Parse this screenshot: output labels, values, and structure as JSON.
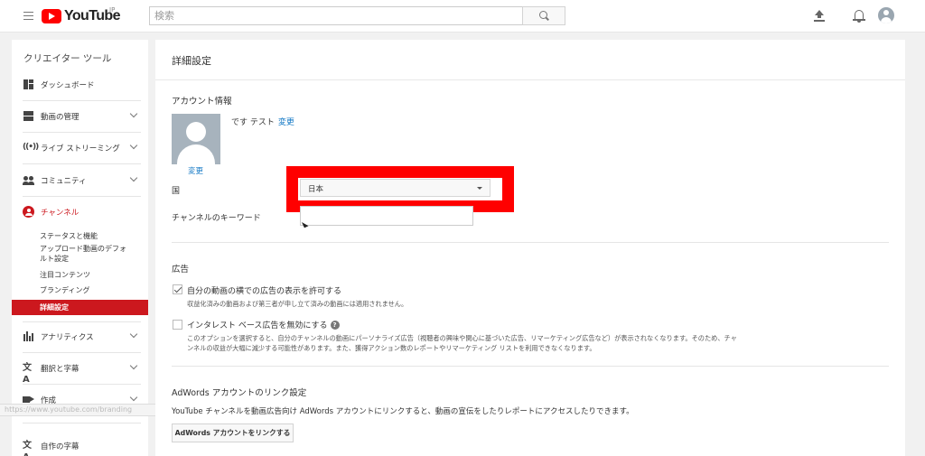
{
  "header": {
    "logo_text": "YouTube",
    "logo_region": "JP",
    "search_placeholder": "検索"
  },
  "sidebar": {
    "title": "クリエイター ツール",
    "items": [
      {
        "label": "ダッシュボード",
        "icon": "dashboard-icon"
      },
      {
        "label": "動画の管理",
        "icon": "video-manager-icon"
      },
      {
        "label": "ライブ ストリーミング",
        "icon": "live-icon"
      },
      {
        "label": "コミュニティ",
        "icon": "community-icon"
      },
      {
        "label": "チャンネル",
        "icon": "channel-icon"
      },
      {
        "label": "アナリティクス",
        "icon": "analytics-icon"
      },
      {
        "label": "翻訳と字幕",
        "icon": "translate-icon"
      },
      {
        "label": "作成",
        "icon": "create-icon"
      },
      {
        "label": "自作の字幕",
        "icon": "translate-icon"
      }
    ],
    "channel_sub": [
      "ステータスと機能",
      "アップロード動画のデフォ",
      "ルト設定",
      "注目コンテンツ",
      "ブランディング",
      "詳細設定"
    ],
    "status_url": "https://www.youtube.com/branding"
  },
  "main": {
    "page_title": "詳細設定",
    "account": {
      "heading": "アカウント情報",
      "name": "です テスト",
      "change_name": "変更",
      "change_avatar": "変更",
      "country_label": "国",
      "country_value": "日本",
      "keywords_label": "チャンネルのキーワード",
      "keywords_value": ""
    },
    "ads": {
      "heading": "広告",
      "allow_label": "自分の動画の横での広告の表示を許可する",
      "allow_desc": "収益化済みの動画および第三者が申し立て済みの動画には適用されません。",
      "allow_checked": true,
      "interest_label": "インタレスト ベース広告を無効にする",
      "interest_desc_1": "このオプションを選択すると、自分のチャンネルの動画にパーソナライズ広告（視聴者の興味や関心に基づいた広告、リマーケティング広告など）が表示されなくなります。そのため、チャ",
      "interest_desc_2": "ンネルの収益が大幅に減少する可能性があります。また、獲得アクション数のレポートやリマーケティング リストを利用できなくなります。",
      "interest_checked": false,
      "help": "?"
    },
    "adwords": {
      "heading": "AdWords アカウントのリンク設定",
      "desc": "YouTube チャンネルを動画広告向け AdWords アカウントにリンクすると、動画の宣伝をしたりレポートにアクセスしたりできます。",
      "button": "AdWords アカウントをリンクする"
    }
  },
  "colors": {
    "brand_red": "#ff0000",
    "active_red": "#cc181e",
    "link_blue": "#167ac6",
    "highlight_red": "#ff0000"
  }
}
